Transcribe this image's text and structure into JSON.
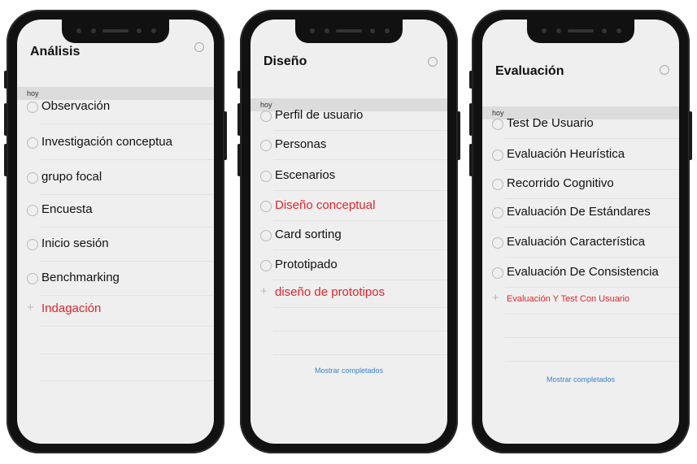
{
  "phones": [
    {
      "title": "Análisis",
      "section": "hoy",
      "items": [
        {
          "label": "Observación"
        },
        {
          "label": "Investigación conceptua"
        },
        {
          "label": "grupo focal"
        },
        {
          "label": "Encuesta"
        },
        {
          "label": "Inicio sesión"
        },
        {
          "label": "Benchmarking"
        }
      ],
      "add_item": {
        "label": "Indagación"
      }
    },
    {
      "title": "Diseño",
      "section": "hoy",
      "items": [
        {
          "label": "Perfil de usuario"
        },
        {
          "label": "Personas"
        },
        {
          "label": "Escenarios"
        },
        {
          "label": "Diseño conceptual",
          "highlight": true
        },
        {
          "label": "Card sorting"
        },
        {
          "label": "Prototipado"
        }
      ],
      "add_item": {
        "label": "diseño de prototipos"
      },
      "show_completed": "Mostrar completados"
    },
    {
      "title": "Evaluación",
      "section": "hoy",
      "items": [
        {
          "label": "Test De Usuario"
        },
        {
          "label": "Evaluación Heurística"
        },
        {
          "label": "Recorrido Cognitivo"
        },
        {
          "label": "Evaluación De Estándares"
        },
        {
          "label": "Evaluación Característica"
        },
        {
          "label": "Evaluación De Consistencia"
        }
      ],
      "add_item": {
        "label": "Evaluación Y Test Con Usuario",
        "small": true
      },
      "show_completed": "Mostrar completados"
    }
  ],
  "colors": {
    "accent_red": "#e0262b",
    "link_blue": "#3a7fd5"
  },
  "icons": {
    "alarm": "alarm-clock-icon",
    "add": "plus-icon",
    "item": "circle-checkbox-icon"
  }
}
